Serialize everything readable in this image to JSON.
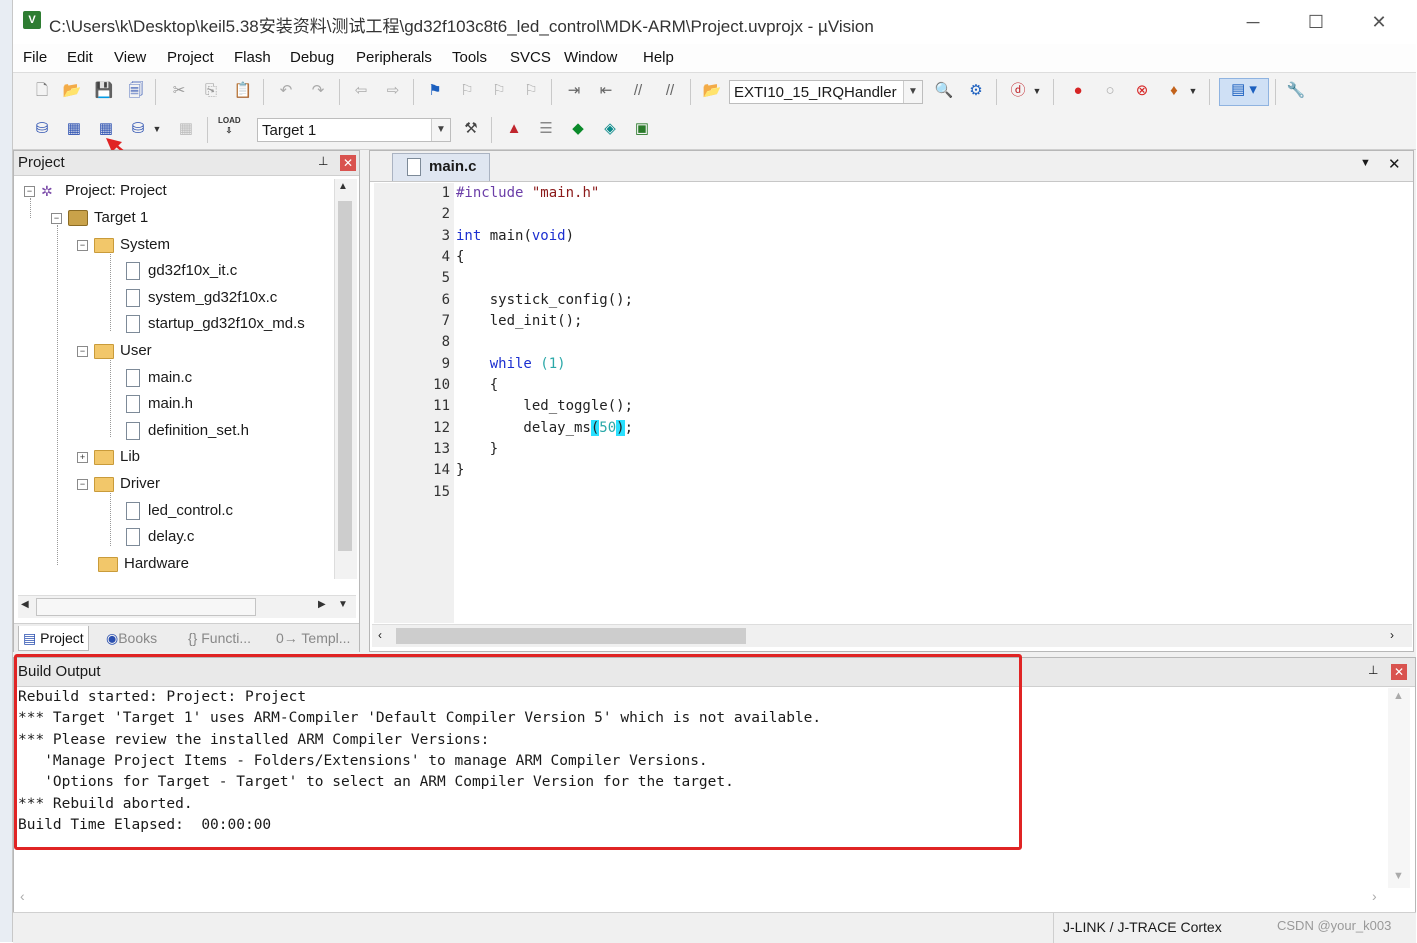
{
  "window": {
    "title": "C:\\Users\\k\\Desktop\\keil5.38安装资料\\测试工程\\gd32f103c8t6_led_control\\MDK-ARM\\Project.uvprojx - µVision",
    "minimize": "─",
    "maximize": "☐",
    "close": "✕"
  },
  "menu": [
    "File",
    "Edit",
    "View",
    "Project",
    "Flash",
    "Debug",
    "Peripherals",
    "Tools",
    "SVCS",
    "Window",
    "Help"
  ],
  "toolbar1": {
    "function_combo": "EXTI10_15_IRQHandler"
  },
  "toolbar2": {
    "target_combo": "Target 1",
    "load_label": "LOAD"
  },
  "project_panel": {
    "title": "Project",
    "pin": "⊥",
    "close": "✕",
    "tree": [
      {
        "label": "Project: Project",
        "kind": "project"
      },
      {
        "label": "Target 1",
        "kind": "target"
      },
      {
        "label": "System",
        "kind": "folder"
      },
      {
        "label": "gd32f10x_it.c",
        "kind": "file"
      },
      {
        "label": "system_gd32f10x.c",
        "kind": "file"
      },
      {
        "label": "startup_gd32f10x_md.s",
        "kind": "file"
      },
      {
        "label": "User",
        "kind": "folder"
      },
      {
        "label": "main.c",
        "kind": "file"
      },
      {
        "label": "main.h",
        "kind": "file"
      },
      {
        "label": "definition_set.h",
        "kind": "file"
      },
      {
        "label": "Lib",
        "kind": "folder"
      },
      {
        "label": "Driver",
        "kind": "folder"
      },
      {
        "label": "led_control.c",
        "kind": "file"
      },
      {
        "label": "delay.c",
        "kind": "file"
      },
      {
        "label": "Hardware",
        "kind": "folder"
      }
    ],
    "tabs": [
      "Project",
      "Books",
      "{} Functi...",
      "0→ Templ..."
    ]
  },
  "editor": {
    "tab": "main.c",
    "line_numbers": [
      "1",
      "2",
      "3",
      "4",
      "5",
      "6",
      "7",
      "8",
      "9",
      "10",
      "11",
      "12",
      "13",
      "14",
      "15"
    ],
    "code": {
      "l1_pp": "#include",
      "l1_str": "\"main.h\"",
      "l3_kw": "int",
      "l3_mid": " main(",
      "l3_kw2": "void",
      "l3_end": ")",
      "l4": "{",
      "l6": "    systick_config();",
      "l7": "    led_init();",
      "l9_kw": "    while",
      "l9_num": " (1)",
      "l10": "    {",
      "l11": "        led_toggle();",
      "l12_a": "        delay_ms",
      "l12_p1": "(",
      "l12_num": "50",
      "l12_p2": ")",
      "l12_end": ";",
      "l13": "    }",
      "l14": "}"
    }
  },
  "build_output": {
    "title": "Build Output",
    "lines": [
      "Rebuild started: Project: Project",
      "*** Target 'Target 1' uses ARM-Compiler 'Default Compiler Version 5' which is not available.",
      "*** Please review the installed ARM Compiler Versions:",
      "   'Manage Project Items - Folders/Extensions' to manage ARM Compiler Versions.",
      "   'Options for Target - Target' to select an ARM Compiler Version for the target.",
      "*** Rebuild aborted.",
      "Build Time Elapsed:  00:00:00"
    ]
  },
  "status": {
    "debugger": "J-LINK / J-TRACE Cortex",
    "watermark": "CSDN @your_k003"
  },
  "colors": {
    "highlight_box": "#e02424",
    "keyword": "#1c2fd0",
    "paren_highlight": "#29e0ff"
  }
}
